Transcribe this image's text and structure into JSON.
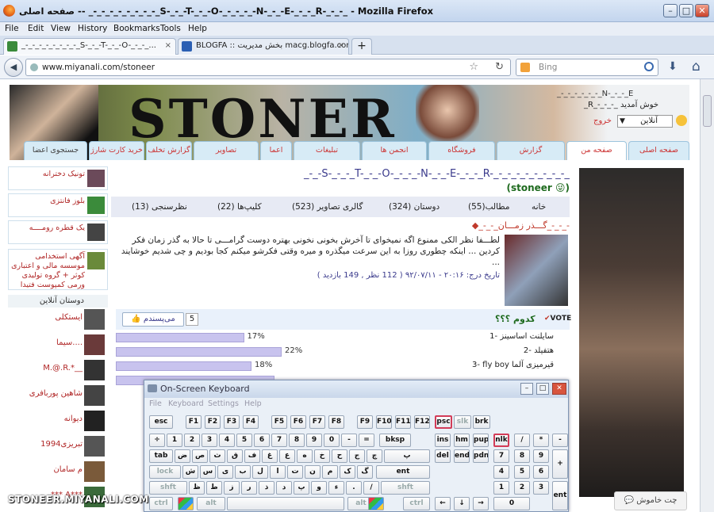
{
  "window": {
    "title": "صفحه اصلی -- _-_-_-_-_-_-_-_-_S-_-_-T-_-_-O-_-_-_-_-N-_-_-E-_-_-_R-_-_-_ - Mozilla Firefox",
    "minimize": "–",
    "maximize": "□",
    "close": "✕"
  },
  "menu": [
    "File",
    "Edit",
    "View",
    "History",
    "Bookmarks",
    "Tools",
    "Help"
  ],
  "tabs": [
    {
      "label": "_-_-_-_-_-_-_-_-_S-_-_-T-_-_-O-_-_-_...",
      "close": "×"
    },
    {
      "label": "BLOGFA :: بخش مدیریت macg.blogfa.com",
      "close": "×"
    },
    {
      "label": "+"
    }
  ],
  "nav": {
    "url": "www.miyanali.com/stoneer",
    "search_engine": "Bing",
    "back": "◀",
    "star": "☆",
    "reload": "↻",
    "download": "⬇",
    "home": "⌂"
  },
  "banner": {
    "logo": "STONER",
    "welcome": "_R_-_-_-_ خوش آمدید",
    "status": "آنلاین",
    "logout": "خروج",
    "top_name": "_-_-_-_-_-_-_N-_-_-_E"
  },
  "site_tabs": [
    "صفحه اصلی",
    "صفحه من",
    "گزارش",
    "فروشگاه",
    "انجمن ها",
    "تبلیغات",
    "اعما",
    "تصاویر",
    "گزارش تخلف",
    "خرید کارت شارژ",
    "جستجوی اعضا"
  ],
  "left_ads": [
    "تونیک دخترانه",
    "بلوز فانتزی",
    "یک قطره رومــــه",
    "آگهی استخدامی موسسه مالی و اعتباری کوثر + گروه تولیدی ورمی کمپوست فتیدا"
  ],
  "online_header": "دوستان آنلاین",
  "online_friends": [
    "ایستکلی",
    "سیما....",
    "M.@.R.*__",
    "شاهین پوربافری",
    "دیوانه",
    "تبریزی1994",
    "م سامان",
    "*** A***"
  ],
  "profile": {
    "heading": "_-_-S-_-_-_T-_-_-O-_-_-_-N-_-_-E-_-_-_R-_-_-_-_-_-_-_-_-_",
    "username": "stoneer",
    "links": [
      {
        "label": "خانه"
      },
      {
        "label": "مطالب",
        "count": "(55)"
      },
      {
        "label": "دوستان",
        "count": "(324)"
      },
      {
        "label": "گالری تصاویر",
        "count": "(523)"
      },
      {
        "label": "کلیپ‌ها",
        "count": "(22)"
      },
      {
        "label": "نظرسنجی",
        "count": "(13)"
      }
    ]
  },
  "post": {
    "title": "◆_-_-_گـــذر زمـــان_-_-_-",
    "body": "لطـــفا نظر الکی ممنوع اگه نمیخوای تا آخرش بخونی نخونی بهتره دوست گرامـــی تا حالا به گذر زمان فکر کردین ... اینکه چطوری روزا به این سرعت میگذره و میره وقتی فکرشو میکنم کجا بودیم و چی شدیم خوشایند ...",
    "meta": "تاریخ درج: ۲۰:۱۶ - ۹۲/۰۷/۱۱ ( 112 نظر , 149 بازدید )"
  },
  "vote": {
    "title": "کدوم ؟؟؟",
    "vote_badge": "VOTE",
    "like_label": "می‌پسندم",
    "like_count": "5",
    "options": [
      {
        "label": "1- سایلنت اساسینز",
        "pct": 17,
        "pct_label": "17%"
      },
      {
        "label": "2- هتفیلد",
        "pct": 22,
        "pct_label": "22%"
      },
      {
        "label": "3- fly boy قیرمیزی آلما",
        "pct": 18,
        "pct_label": "18%"
      },
      {
        "label": "",
        "pct": 21,
        "pct_label": ""
      }
    ]
  },
  "chat": {
    "label": "چت خاموش"
  },
  "watermark": "STONEER.MIYANALI.COM",
  "osk": {
    "title": "On-Screen Keyboard",
    "menu": [
      "File",
      "Keyboard",
      "Settings",
      "Help"
    ],
    "rows": [
      [
        "esc",
        "F1",
        "F2",
        "F3",
        "F4",
        "F5",
        "F6",
        "F7",
        "F8",
        "F9",
        "F10",
        "F11",
        "F12",
        "psc",
        "slk",
        "brk"
      ],
      [
        "÷",
        "1",
        "2",
        "3",
        "4",
        "5",
        "6",
        "7",
        "8",
        "9",
        "0",
        "-",
        "=",
        "bksp",
        "ins",
        "hm",
        "pup",
        "nlk",
        "/",
        "*",
        "-"
      ],
      [
        "tab",
        "ض",
        "ص",
        "ث",
        "ق",
        "ف",
        "غ",
        "ع",
        "ه",
        "خ",
        "ح",
        "ج",
        "چ",
        "پ",
        "del",
        "end",
        "pdn",
        "7",
        "8",
        "9",
        "+"
      ],
      [
        "lock",
        "ش",
        "س",
        "ی",
        "ب",
        "ل",
        "ا",
        "ت",
        "ن",
        "م",
        "ک",
        "گ",
        "ent",
        "4",
        "5",
        "6"
      ],
      [
        "shft",
        "ظ",
        "ط",
        "ز",
        "ر",
        "ذ",
        "د",
        "پ",
        "و",
        "ء",
        ".",
        "/",
        "shft",
        "1",
        "2",
        "3"
      ],
      [
        "ctrl",
        "alt",
        "alt",
        "ctrl",
        "←",
        "↓",
        "→",
        "0",
        "ent"
      ]
    ]
  }
}
